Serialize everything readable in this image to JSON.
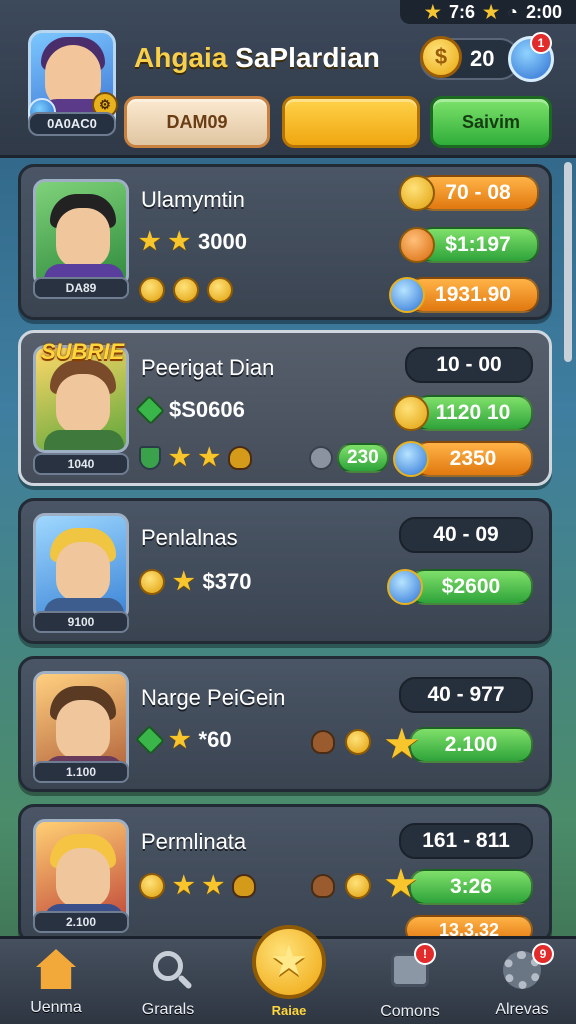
{
  "status": {
    "time_a": "7:6",
    "time_b": "2:00"
  },
  "header": {
    "player_name_gold": "Ahgaia",
    "player_name_white": "SaPlardian",
    "avatar_label": "0A0AC0",
    "coins": "20",
    "settings_badge": "1",
    "buttons": {
      "beige": "DAM09",
      "yellow": "",
      "green": "Saivim"
    }
  },
  "cards": [
    {
      "title": "Ulamymtin",
      "stat": "3000",
      "portrait_label": "DA89",
      "pills": [
        "70 - 08",
        "$1:197",
        "1931.90"
      ]
    },
    {
      "badge": "SUBRIE",
      "title": "Peerigat Dian",
      "stat": "$S0606",
      "portrait_label": "1040",
      "pills": [
        "10 - 00",
        "1120 10",
        "2350"
      ],
      "extra_chip": "230"
    },
    {
      "title": "Penlalnas",
      "stat": "$370",
      "portrait_label": "9100",
      "pills": [
        "40 - 09",
        "$2600"
      ]
    },
    {
      "title": "Narge PeiGein",
      "stat": "*60",
      "portrait_label": "1.100",
      "pills": [
        "40 - 977",
        "2.100"
      ]
    },
    {
      "title": "Permlinata",
      "portrait_label": "2.100",
      "pills": [
        "161 - 811",
        "3:26",
        "13.3.32"
      ]
    }
  ],
  "nav": {
    "items": [
      "Uenma",
      "Grarals",
      "Raiae",
      "Comons",
      "Alrevas"
    ],
    "comons_badge": "!",
    "alrevas_badge": "9"
  },
  "colors": {
    "gold": "#f7cf4a",
    "green": "#2fae3a",
    "orange": "#e0780f",
    "panel": "#3a4451"
  }
}
